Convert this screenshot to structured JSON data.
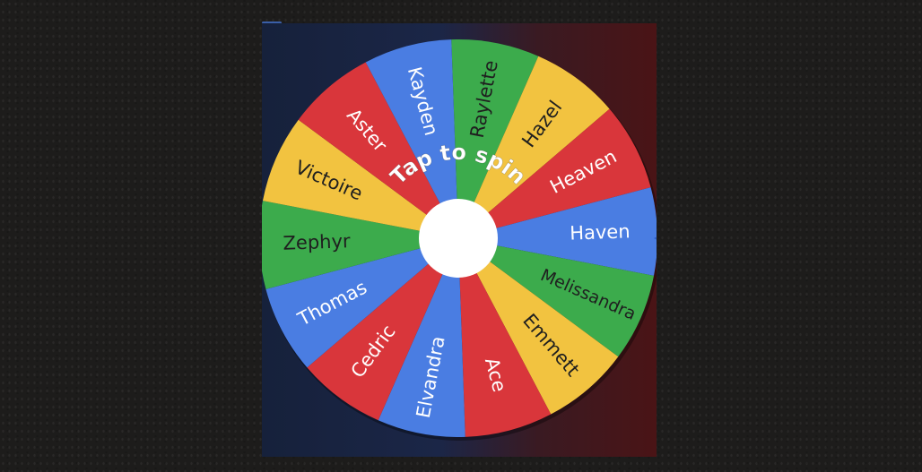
{
  "game": {
    "spin_prompt": "Tap to spin",
    "pointer_icon": "pointer-arrow-icon",
    "segments": [
      {
        "label": "Raylette",
        "color": "#3cab4c"
      },
      {
        "label": "Hazel",
        "color": "#f2c340"
      },
      {
        "label": "Heaven",
        "color": "#d9363b"
      },
      {
        "label": "Haven",
        "color": "#4a7de2"
      },
      {
        "label": "Melissandra",
        "color": "#3cab4c"
      },
      {
        "label": "Emmett",
        "color": "#f2c340"
      },
      {
        "label": "Ace",
        "color": "#d9363b"
      },
      {
        "label": "Elvandra",
        "color": "#4a7de2"
      },
      {
        "label": "Cedric",
        "color": "#d9363b"
      },
      {
        "label": "Thomas",
        "color": "#4a7de2"
      },
      {
        "label": "Zephyr",
        "color": "#3cab4c"
      },
      {
        "label": "Victoire",
        "color": "#f2c340"
      },
      {
        "label": "Aster",
        "color": "#d9363b"
      },
      {
        "label": "Kayden",
        "color": "#4a7de2"
      }
    ],
    "label_color": "#1f1f1f",
    "label_color_light": "#ffffff",
    "hub_color": "#ffffff"
  }
}
